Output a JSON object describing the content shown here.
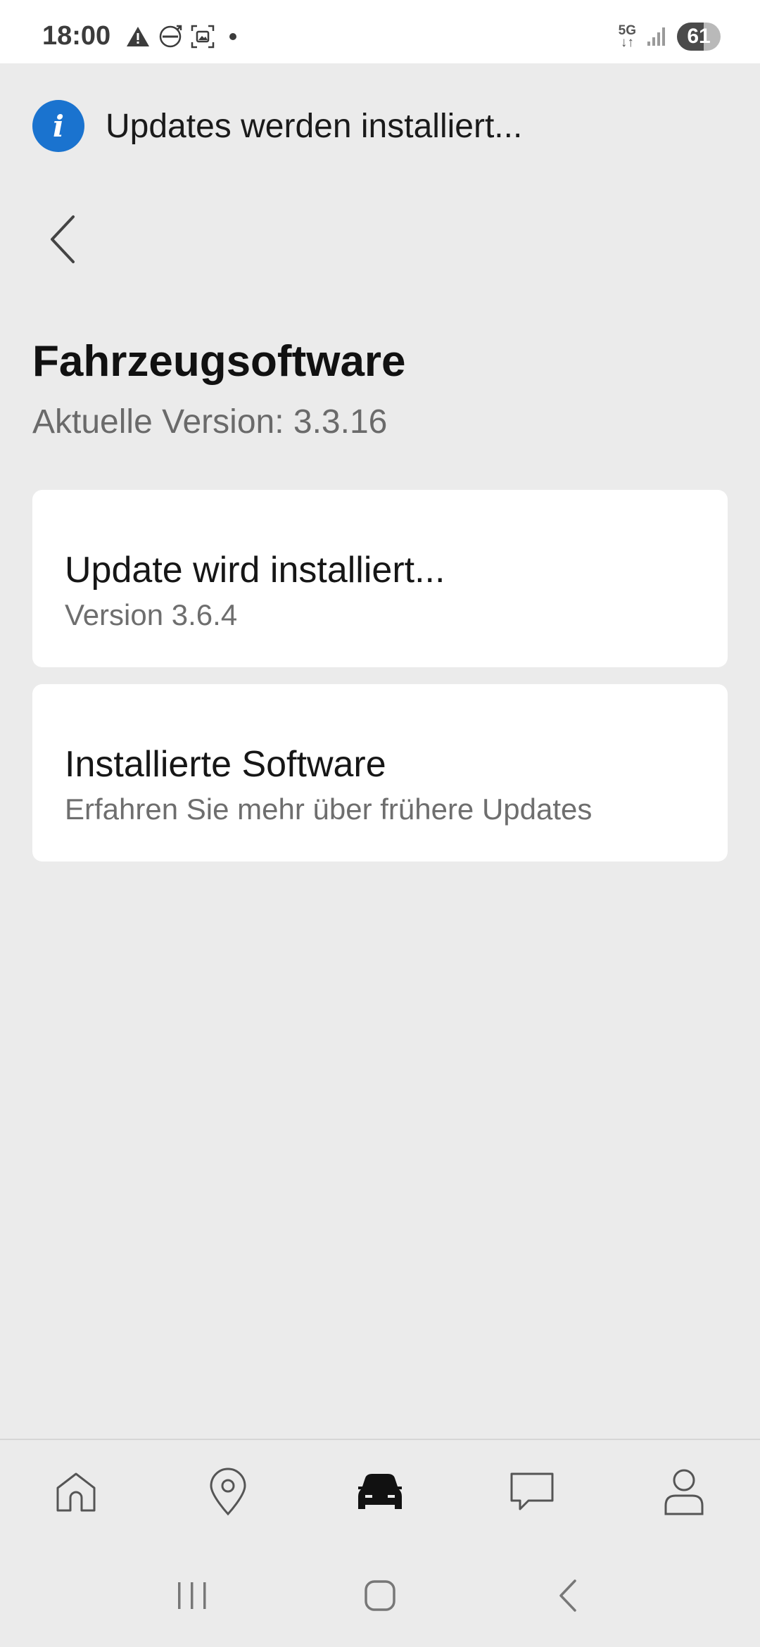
{
  "status_bar": {
    "time": "18:00",
    "left_icons": [
      "warning-icon",
      "volvo-logo-icon",
      "screenshot-icon",
      "dot-icon"
    ],
    "network": "5G",
    "battery_level": "61",
    "battery_fraction": 0.61
  },
  "banner": {
    "icon": "info-icon",
    "text": "Updates werden installiert..."
  },
  "header": {
    "title": "Fahrzeugsoftware",
    "subtitle": "Aktuelle Version: 3.3.16"
  },
  "cards": [
    {
      "title": "Update wird installiert...",
      "subtitle": "Version 3.6.4"
    },
    {
      "title": "Installierte Software",
      "subtitle": "Erfahren Sie mehr über frühere Updates"
    }
  ],
  "bottom_nav": [
    {
      "icon": "home-icon",
      "active": false
    },
    {
      "icon": "location-pin-icon",
      "active": false
    },
    {
      "icon": "car-icon",
      "active": true
    },
    {
      "icon": "chat-icon",
      "active": false
    },
    {
      "icon": "profile-icon",
      "active": false
    }
  ],
  "system_nav": [
    "recent-apps-icon",
    "home-button-icon",
    "back-icon"
  ],
  "colors": {
    "background": "#ebebeb",
    "card": "#ffffff",
    "info_accent": "#1a73cf",
    "subtitle_text": "#6a6a6a"
  }
}
